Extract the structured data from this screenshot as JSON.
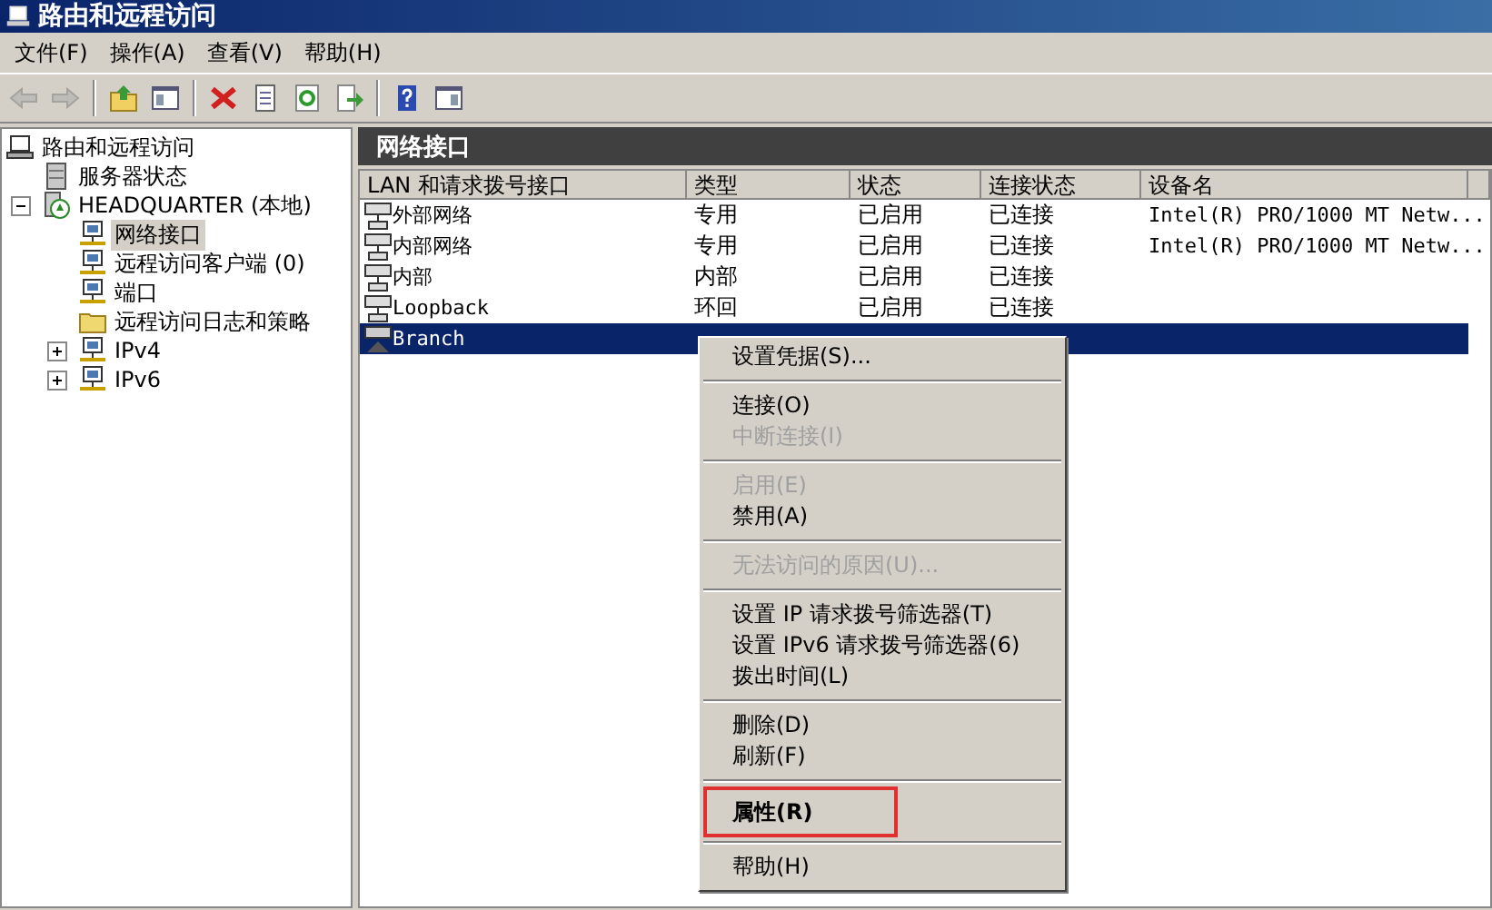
{
  "window": {
    "title": "路由和远程访问"
  },
  "menu_bar": [
    "文件(F)",
    "操作(A)",
    "查看(V)",
    "帮助(H)"
  ],
  "toolbar": [
    {
      "kind": "back",
      "disabled": true
    },
    {
      "kind": "forward",
      "disabled": true
    },
    {
      "kind": "separator"
    },
    {
      "kind": "up"
    },
    {
      "kind": "tree"
    },
    {
      "kind": "separator"
    },
    {
      "kind": "delete"
    },
    {
      "kind": "properties"
    },
    {
      "kind": "refresh"
    },
    {
      "kind": "export"
    },
    {
      "kind": "separator"
    },
    {
      "kind": "help"
    },
    {
      "kind": "view"
    }
  ],
  "tree": [
    {
      "label": "路由和远程访问",
      "kind": "computer",
      "selected": false,
      "children": [
        {
          "label": "服务器状态",
          "kind": "server",
          "selected": false
        },
        {
          "label": "HEADQUARTER (本地)",
          "kind": "host",
          "selected": false,
          "expanded": true,
          "children": [
            {
              "label": "网络接口",
              "kind": "network",
              "selected": true
            },
            {
              "label": "远程访问客户端 (0)",
              "kind": "network",
              "selected": false
            },
            {
              "label": "端口",
              "kind": "network",
              "selected": false
            },
            {
              "label": "远程访问日志和策略",
              "kind": "folder",
              "selected": false
            },
            {
              "label": "IPv4",
              "kind": "network",
              "selected": false,
              "expanded": false
            },
            {
              "label": "IPv6",
              "kind": "network",
              "selected": false,
              "expanded": false
            }
          ]
        }
      ]
    }
  ],
  "panel": {
    "title": "网络接口"
  },
  "table": {
    "columns": [
      "LAN 和请求拨号接口",
      "类型",
      "状态",
      "连接状态",
      "设备名"
    ],
    "rows": [
      {
        "selected": false,
        "kind": "lan",
        "cells": [
          "外部网络",
          "专用",
          "已启用",
          "已连接",
          "Intel(R) PRO/1000 MT Netw..."
        ]
      },
      {
        "selected": false,
        "kind": "lan",
        "cells": [
          "内部网络",
          "专用",
          "已启用",
          "已连接",
          "Intel(R) PRO/1000 MT Netw..."
        ]
      },
      {
        "selected": false,
        "kind": "lan",
        "cells": [
          "内部",
          "内部",
          "已启用",
          "已连接"
        ]
      },
      {
        "selected": false,
        "kind": "lan",
        "cells": [
          "Loopback",
          "环回",
          "已启用",
          "已连接"
        ]
      },
      {
        "selected": true,
        "kind": "dial",
        "cells": [
          "Branch"
        ]
      }
    ]
  },
  "context_menu": [
    {
      "kind": "item",
      "label": "设置凭据(S)...",
      "disabled": false,
      "default": false,
      "marked": false
    },
    {
      "kind": "separator"
    },
    {
      "kind": "item",
      "label": "连接(O)",
      "disabled": false,
      "default": false,
      "marked": false
    },
    {
      "kind": "item",
      "label": "中断连接(I)",
      "disabled": true,
      "default": false,
      "marked": false
    },
    {
      "kind": "separator"
    },
    {
      "kind": "item",
      "label": "启用(E)",
      "disabled": true,
      "default": false,
      "marked": false
    },
    {
      "kind": "item",
      "label": "禁用(A)",
      "disabled": false,
      "default": false,
      "marked": false
    },
    {
      "kind": "separator"
    },
    {
      "kind": "item",
      "label": "无法访问的原因(U)...",
      "disabled": true,
      "default": false,
      "marked": false
    },
    {
      "kind": "separator"
    },
    {
      "kind": "item",
      "label": "设置 IP 请求拨号筛选器(T)",
      "disabled": false,
      "default": false,
      "marked": false
    },
    {
      "kind": "item",
      "label": "设置 IPv6 请求拨号筛选器(6)",
      "disabled": false,
      "default": false,
      "marked": false
    },
    {
      "kind": "item",
      "label": "拨出时间(L)",
      "disabled": false,
      "default": false,
      "marked": false
    },
    {
      "kind": "separator"
    },
    {
      "kind": "item",
      "label": "删除(D)",
      "disabled": false,
      "default": false,
      "marked": false
    },
    {
      "kind": "item",
      "label": "刷新(F)",
      "disabled": false,
      "default": false,
      "marked": false
    },
    {
      "kind": "separator"
    },
    {
      "kind": "item",
      "label": "属性(R)",
      "disabled": false,
      "default": true,
      "marked": true
    },
    {
      "kind": "separator"
    },
    {
      "kind": "item",
      "label": "帮助(H)",
      "disabled": false,
      "default": false,
      "marked": false
    }
  ]
}
